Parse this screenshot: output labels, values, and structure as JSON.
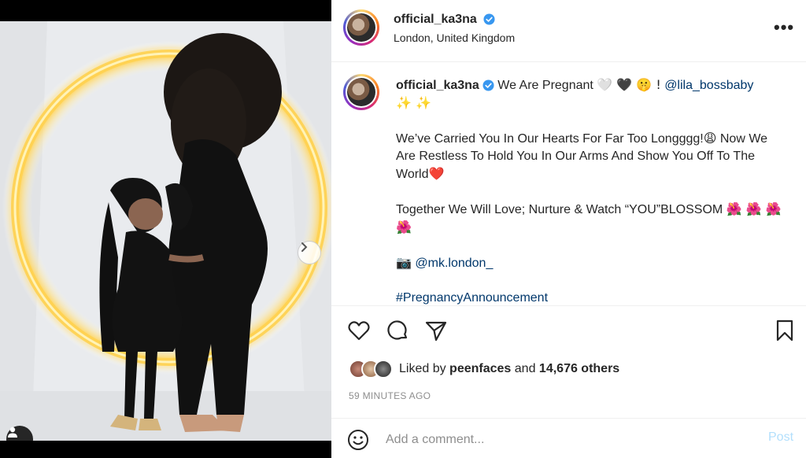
{
  "post": {
    "username": "official_ka3na",
    "location": "London, United Kingdom",
    "more_label": "•••",
    "media_slides": 4,
    "active_slide": 1
  },
  "caption": {
    "username": "official_ka3na",
    "line1_text": "We Are Pregnant",
    "line1_emojis": "🤍 🖤 🤫 !",
    "mention1": "@lila_bossbaby",
    "sparkles": "✨ ✨",
    "para2": "We’ve Carried You In Our Hearts For Far Too Longggg!",
    "para2_emoji": "😩",
    "para2b": "Now We Are Restless To Hold You In Our Arms And Show You Off To The World",
    "para2_heart": "❤️",
    "para3": "Together We Will Love; Nurture & Watch “YOU”BLOSSOM",
    "para3_flowers": "🌺 🌺 🌺 🌺",
    "camera_emoji": "📷",
    "mention2": "@mk.london_",
    "hashtag": "#PregnancyAnnouncement"
  },
  "engagement": {
    "liked_by_prefix": "Liked by",
    "liked_by_user": "peenfaces",
    "and_label": "and",
    "others_count": "14,676 others",
    "time_ago": "59 MINUTES AGO"
  },
  "comment": {
    "placeholder": "Add a comment...",
    "post_label": "Post"
  },
  "icons": {
    "like": "heart-icon",
    "comment": "comment-icon",
    "share": "paper-plane-icon",
    "save": "bookmark-icon",
    "verified": "verified-badge-icon",
    "emoji": "smiley-icon",
    "tag": "person-icon",
    "next": "chevron-right-icon"
  },
  "colors": {
    "link": "#00376b",
    "verified": "#3897f0",
    "post_disabled": "#b2dffc",
    "muted": "#8e8e8e"
  }
}
